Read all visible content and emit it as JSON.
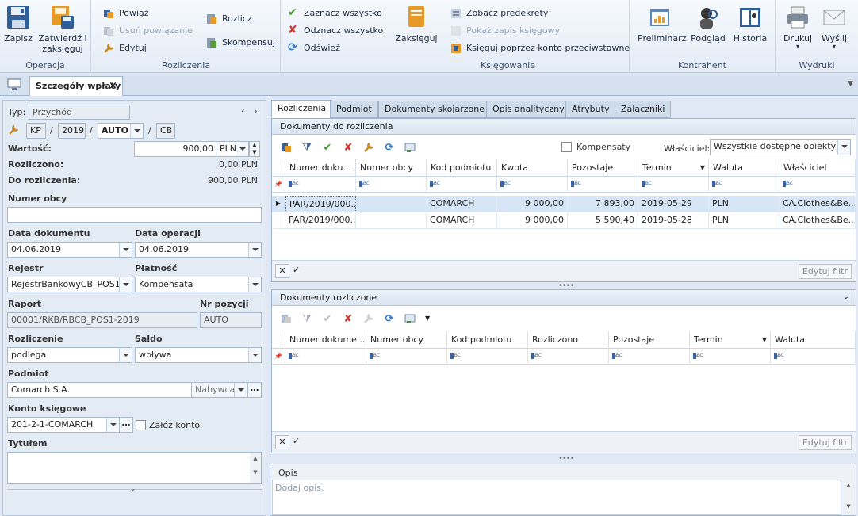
{
  "ribbon": {
    "operacja": {
      "title": "Operacja",
      "save": "Zapisz",
      "confirm": "Zatwierdź i zaksięguj"
    },
    "rozliczenia": {
      "title": "Rozliczenia",
      "link": "Powiąż",
      "unlink": "Usuń powiązanie",
      "edit": "Edytuj",
      "settle": "Rozlicz",
      "compensate": "Skompensuj",
      "select_all": "Zaznacz wszystko",
      "deselect_all": "Odznacz wszystko",
      "refresh": "Odśwież"
    },
    "ksiegowanie": {
      "title": "Księgowanie",
      "post": "Zaksięguj",
      "preview_decree": "Zobacz predekrety",
      "show_entry": "Pokaż zapis księgowy",
      "post_via": "Księguj poprzez konto przeciwstawne"
    },
    "kontrahent": {
      "title": "Kontrahent",
      "preliminarz": "Preliminarz",
      "podglad": "Podgląd",
      "historia": "Historia"
    },
    "wydruki": {
      "title": "Wydruki",
      "print": "Drukuj",
      "send": "Wyślij"
    }
  },
  "doc_tab": {
    "label": "Szczegóły wpłaty"
  },
  "form": {
    "typ_label": "Typ:",
    "typ_value": "Przychód",
    "kp": "KP",
    "slash1": "/",
    "year": "2019",
    "slash2": "/",
    "auto": "AUTO",
    "slash3": "/",
    "cb": "CB",
    "wartosc_label": "Wartość:",
    "wartosc_value": "900,00",
    "currency": "PLN",
    "rozliczono_label": "Rozliczono:",
    "rozliczono_value": "0,00 PLN",
    "do_rozliczenia_label": "Do rozliczenia:",
    "do_rozliczenia_value": "900,00 PLN",
    "numer_obcy_label": "Numer obcy",
    "numer_obcy_value": "",
    "data_dokumentu_label": "Data dokumentu",
    "data_dokumentu_value": "04.06.2019",
    "data_operacji_label": "Data operacji",
    "data_operacji_value": "04.06.2019",
    "rejestr_label": "Rejestr",
    "rejestr_value": "RejestrBankowyCB_POS1",
    "platnosc_label": "Płatność",
    "platnosc_value": "Kompensata",
    "raport_label": "Raport",
    "raport_value": "00001/RKB/RBCB_POS1-2019",
    "nr_pozycji_label": "Nr pozycji",
    "nr_pozycji_value": "AUTO",
    "rozliczenie_label": "Rozliczenie",
    "rozliczenie_value": "podlega",
    "saldo_label": "Saldo",
    "saldo_value": "wpływa",
    "podmiot_label": "Podmiot",
    "podmiot_value": "Comarch S.A.",
    "podmiot_role": "Nabywca",
    "konto_label": "Konto księgowe",
    "konto_value": "201-2-1-COMARCH",
    "zaloz_konto": "Załóż konto",
    "tytulem_label": "Tytułem",
    "tytulem_value": ""
  },
  "right_tabs": [
    "Rozliczenia",
    "Podmiot",
    "Dokumenty skojarzone",
    "Opis analityczny",
    "Atrybuty",
    "Załączniki"
  ],
  "do_rozliczenia": {
    "title": "Dokumenty do rozliczenia",
    "kompensaty_label": "Kompensaty",
    "wlasciciel_label": "Właściciel:",
    "wlasciciel_value": "Wszystkie dostępne obiekty",
    "columns": [
      "Numer doku...",
      "Numer obcy",
      "Kod podmiotu",
      "Kwota",
      "Pozostaje",
      "Termin",
      "Waluta",
      "Właściciel"
    ],
    "rows": [
      [
        "PAR/2019/000...",
        "",
        "COMARCH",
        "9 000,00",
        "7 893,00",
        "2019-05-29",
        "PLN",
        "CA.Clothes&Be..."
      ],
      [
        "PAR/2019/000...",
        "",
        "COMARCH",
        "9 000,00",
        "5 590,40",
        "2019-05-28",
        "PLN",
        "CA.Clothes&Be..."
      ]
    ],
    "filter_btn": "Edytuj filtr"
  },
  "rozliczone": {
    "title": "Dokumenty rozliczone",
    "columns": [
      "Numer dokume...",
      "Numer obcy",
      "Kod podmiotu",
      "Rozliczono",
      "Pozostaje",
      "Termin",
      "Waluta"
    ],
    "filter_btn": "Edytuj filtr"
  },
  "opis": {
    "title": "Opis",
    "placeholder": "Dodaj opis."
  },
  "filter_placeholder": "ABC",
  "colors": {
    "accent": "#3a62a0",
    "selected_row": "#d6e6f7",
    "ribbon_bg": "#eef3f9"
  }
}
